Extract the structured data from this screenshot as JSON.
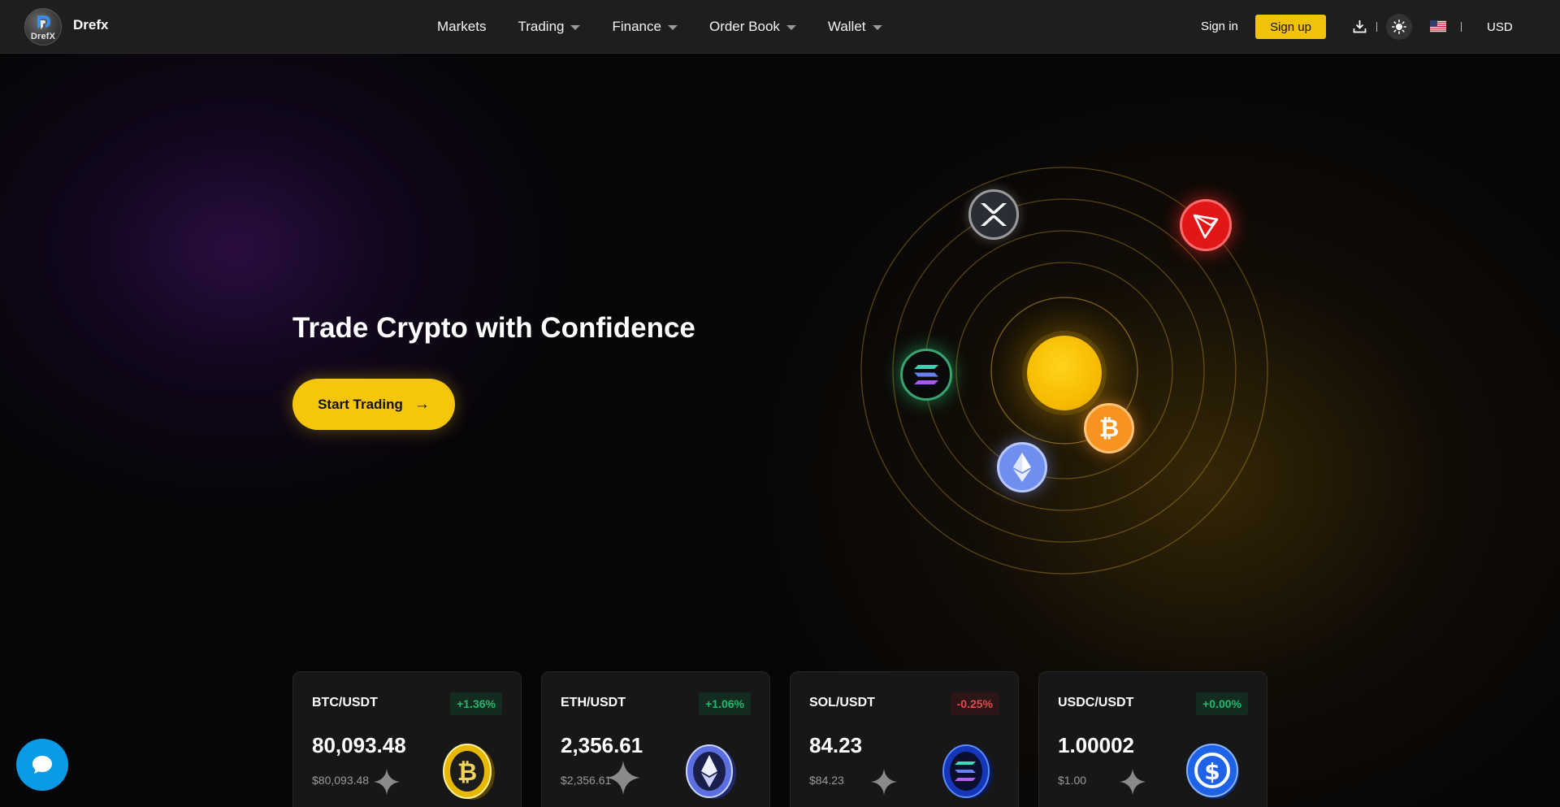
{
  "brand": {
    "name": "Drefx",
    "logo_text": "DrefX"
  },
  "nav": {
    "items": [
      {
        "label": "Markets",
        "dropdown": false
      },
      {
        "label": "Trading",
        "dropdown": true
      },
      {
        "label": "Finance",
        "dropdown": true
      },
      {
        "label": "Order Book",
        "dropdown": true
      },
      {
        "label": "Wallet",
        "dropdown": true
      }
    ],
    "sign_in": "Sign in",
    "sign_up": "Sign up",
    "currency": "USD",
    "icons": [
      "download-icon",
      "sun-icon",
      "us-flag-icon"
    ]
  },
  "hero": {
    "title": "Trade Crypto with Confidence",
    "cta_label": "Start Trading",
    "cta_arrow": "→",
    "orbit_coins": [
      "xrp",
      "tron",
      "solana",
      "sun",
      "bitcoin",
      "ethereum"
    ]
  },
  "tickers": [
    {
      "pair": "BTC/USDT",
      "change": "+1.36%",
      "direction": "up",
      "price": "80,093.48",
      "fiat": "$80,093.48",
      "coin": "bitcoin"
    },
    {
      "pair": "ETH/USDT",
      "change": "+1.06%",
      "direction": "up",
      "price": "2,356.61",
      "fiat": "$2,356.61",
      "coin": "ethereum"
    },
    {
      "pair": "SOL/USDT",
      "change": "-0.25%",
      "direction": "down",
      "price": "84.23",
      "fiat": "$84.23",
      "coin": "solana"
    },
    {
      "pair": "USDC/USDT",
      "change": "+0.00%",
      "direction": "up",
      "price": "1.00002",
      "fiat": "$1.00",
      "coin": "usdc"
    }
  ],
  "colors": {
    "accent": "#f5c60c",
    "up": "#1fb96e",
    "down": "#e5484d",
    "chat": "#0a9be6"
  }
}
